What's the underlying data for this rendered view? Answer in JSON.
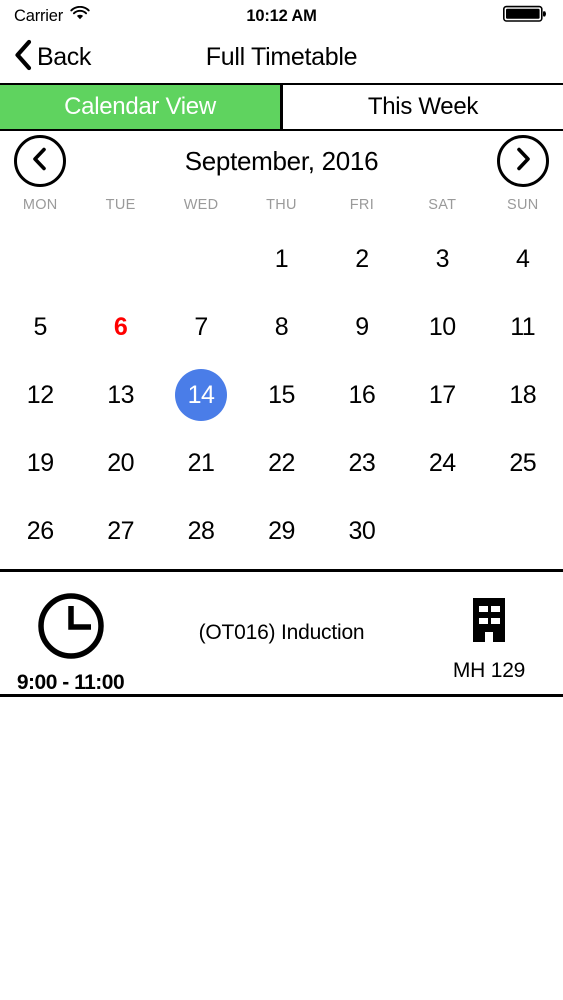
{
  "status_bar": {
    "carrier": "Carrier",
    "wifi_icon": "wifi-icon",
    "time": "10:12 AM",
    "battery_icon": "battery-full-icon"
  },
  "nav_bar": {
    "back_label": "Back",
    "back_icon": "chevron-left-icon",
    "title": "Full Timetable"
  },
  "segmented_control": {
    "active_index": 0,
    "active_color": "#5fd35f",
    "segments": [
      {
        "label": "Calendar View",
        "active": true
      },
      {
        "label": "This Week",
        "active": false
      }
    ]
  },
  "calendar": {
    "month_title": "September, 2016",
    "prev_icon": "chevron-left-icon",
    "next_icon": "chevron-right-icon",
    "weekdays": [
      "MON",
      "TUE",
      "WED",
      "THU",
      "FRI",
      "SAT",
      "SUN"
    ],
    "today_color": "#ff0000",
    "selected_color": "#4a7de8",
    "today": 6,
    "selected": 14,
    "weeks": [
      [
        "",
        "",
        "",
        "1",
        "2",
        "3",
        "4"
      ],
      [
        "5",
        "6",
        "7",
        "8",
        "9",
        "10",
        "11"
      ],
      [
        "12",
        "13",
        "14",
        "15",
        "16",
        "17",
        "18"
      ],
      [
        "19",
        "20",
        "21",
        "22",
        "23",
        "24",
        "25"
      ],
      [
        "26",
        "27",
        "28",
        "29",
        "30",
        "",
        ""
      ]
    ]
  },
  "event": {
    "clock_icon": "clock-icon",
    "time": "9:00 - 11:00",
    "title": "(OT016) Induction",
    "building_icon": "building-icon",
    "location": "MH 129"
  }
}
